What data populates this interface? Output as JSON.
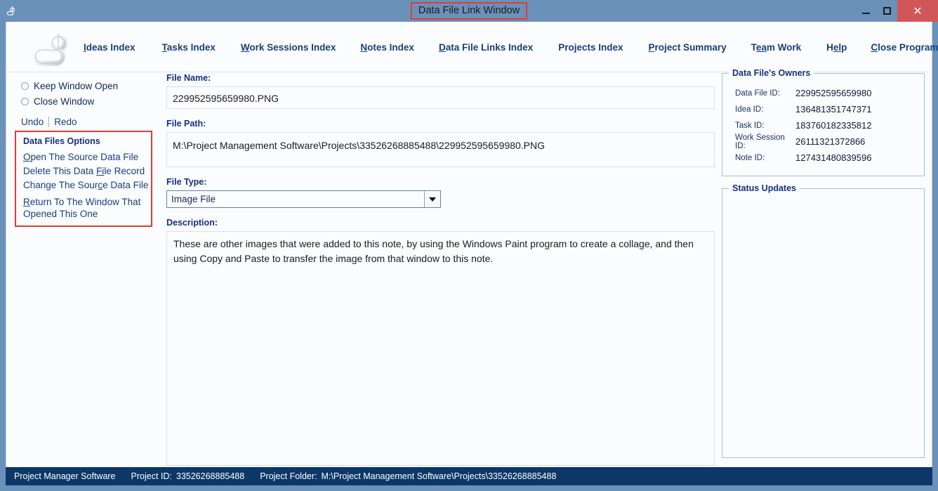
{
  "window": {
    "title": "Data File Link Window",
    "app_icon": "app-logo-icon",
    "minimize_label": "",
    "maximize_label": "",
    "close_label": "✕",
    "title_highlight_color": "#e23b36",
    "titlebar_color": "#6a91ba",
    "close_button_color": "#d0565a"
  },
  "nav": {
    "items": [
      {
        "label": "Ideas Index",
        "accel": "I",
        "accel_index": 0,
        "accel_len": 1
      },
      {
        "label": "Tasks Index",
        "accel": "T",
        "accel_index": 0,
        "accel_len": 1
      },
      {
        "label": "Work Sessions Index",
        "accel": "W",
        "accel_index": 0,
        "accel_len": 1
      },
      {
        "label": "Notes Index",
        "accel": "N",
        "accel_index": 0,
        "accel_len": 1
      },
      {
        "label": "Data File Links Index",
        "accel": "D",
        "accel_index": 0,
        "accel_len": 1
      },
      {
        "label": "Projects Index",
        "accel": "",
        "accel_index": -1,
        "accel_len": 0
      },
      {
        "label": "Project Summary",
        "accel": "P",
        "accel_index": 0,
        "accel_len": 1
      },
      {
        "label": "Team Work",
        "accel": "ea",
        "accel_index": 1,
        "accel_len": 2
      },
      {
        "label": "Help",
        "accel": "el",
        "accel_index": 1,
        "accel_len": 2
      },
      {
        "label": "Close Program",
        "accel": "C",
        "accel_index": 0,
        "accel_len": 1
      }
    ]
  },
  "sidebar": {
    "radios": [
      {
        "label": "Keep Window Open",
        "accel_index": 0,
        "accel_len": 1,
        "selected": false
      },
      {
        "label": "Close Window",
        "accel_index": 1,
        "accel_len": 1,
        "selected": false
      }
    ],
    "undo_label": "Undo",
    "redo_label": "Redo",
    "options_title": "Data Files Options",
    "options": [
      {
        "label": "Open The Source Data File",
        "accel_index": 0,
        "accel_len": 1
      },
      {
        "label": "Delete This Data File Record",
        "accel_index": 17,
        "accel_len": 2
      },
      {
        "label": "Change The Source Data File",
        "accel_index": 15,
        "accel_len": 1
      },
      {
        "label": "Return To The Window That Opened This One",
        "accel_index": 0,
        "accel_len": 1
      }
    ],
    "options_highlight_color": "#e23b36"
  },
  "form": {
    "file_name_label": "File Name:",
    "file_name_value": "229952595659980.PNG",
    "file_path_label": "File Path:",
    "file_path_value": "M:\\Project Management Software\\Projects\\33526268885488\\229952595659980.PNG",
    "file_type_label": "File Type:",
    "file_type_value": "Image File",
    "file_type_options": [
      "Image File"
    ],
    "description_label": "Description:",
    "description_value": "These are other images that were added to this note, by using the Windows Paint program to create a collage, and then using Copy and Paste to transfer the image from that window to this note."
  },
  "owners": {
    "legend": "Data File's Owners",
    "rows": [
      {
        "key": "Data File ID:",
        "value": "229952595659980"
      },
      {
        "key": "Idea ID:",
        "value": "136481351747371"
      },
      {
        "key": "Task ID:",
        "value": "183760182335812"
      },
      {
        "key": "Work Session ID:",
        "value": "26111321372866"
      },
      {
        "key": "Note ID:",
        "value": "127431480839596"
      }
    ]
  },
  "status_updates": {
    "legend": "Status Updates",
    "content": ""
  },
  "statusbar": {
    "app_name": "Project Manager Software",
    "project_id_label": "Project ID:",
    "project_id_value": "33526268885488",
    "project_folder_label": "Project Folder:",
    "project_folder_value": "M:\\Project Management Software\\Projects\\33526268885488",
    "background_color": "#0b3868"
  }
}
